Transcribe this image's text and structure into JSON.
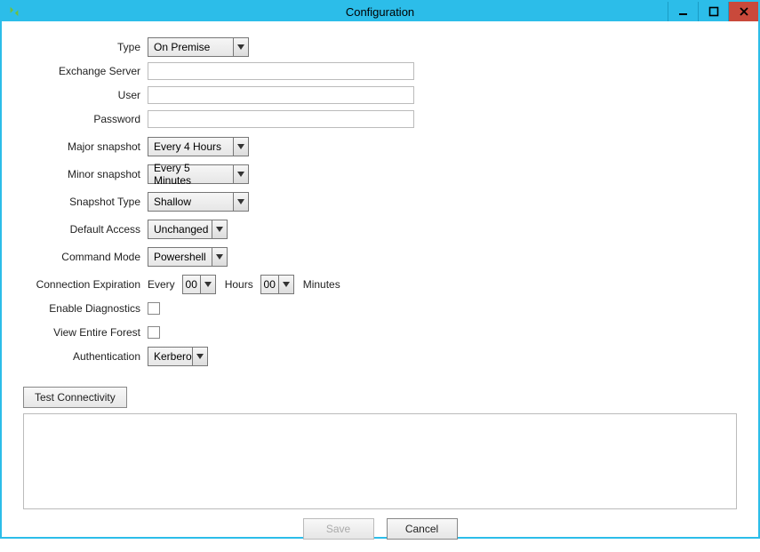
{
  "window": {
    "title": "Configuration"
  },
  "labels": {
    "type": "Type",
    "exchange_server": "Exchange Server",
    "user": "User",
    "password": "Password",
    "major_snapshot": "Major snapshot",
    "minor_snapshot": "Minor snapshot",
    "snapshot_type": "Snapshot Type",
    "default_access": "Default Access",
    "command_mode": "Command Mode",
    "connection_expiration": "Connection Expiration",
    "enable_diagnostics": "Enable Diagnostics",
    "view_entire_forest": "View Entire Forest",
    "authentication": "Authentication",
    "every": "Every",
    "hours": "Hours",
    "minutes": "Minutes"
  },
  "values": {
    "type": "On Premise",
    "exchange_server": "",
    "user": "",
    "password": "",
    "major_snapshot": "Every 4 Hours",
    "minor_snapshot": "Every 5 Minutes",
    "snapshot_type": "Shallow",
    "default_access": "Unchanged",
    "command_mode": "Powershell",
    "exp_hours": "00",
    "exp_minutes": "00",
    "enable_diagnostics": false,
    "view_entire_forest": false,
    "authentication": "Kerberos"
  },
  "buttons": {
    "test_connectivity": "Test Connectivity",
    "save": "Save",
    "cancel": "Cancel"
  }
}
